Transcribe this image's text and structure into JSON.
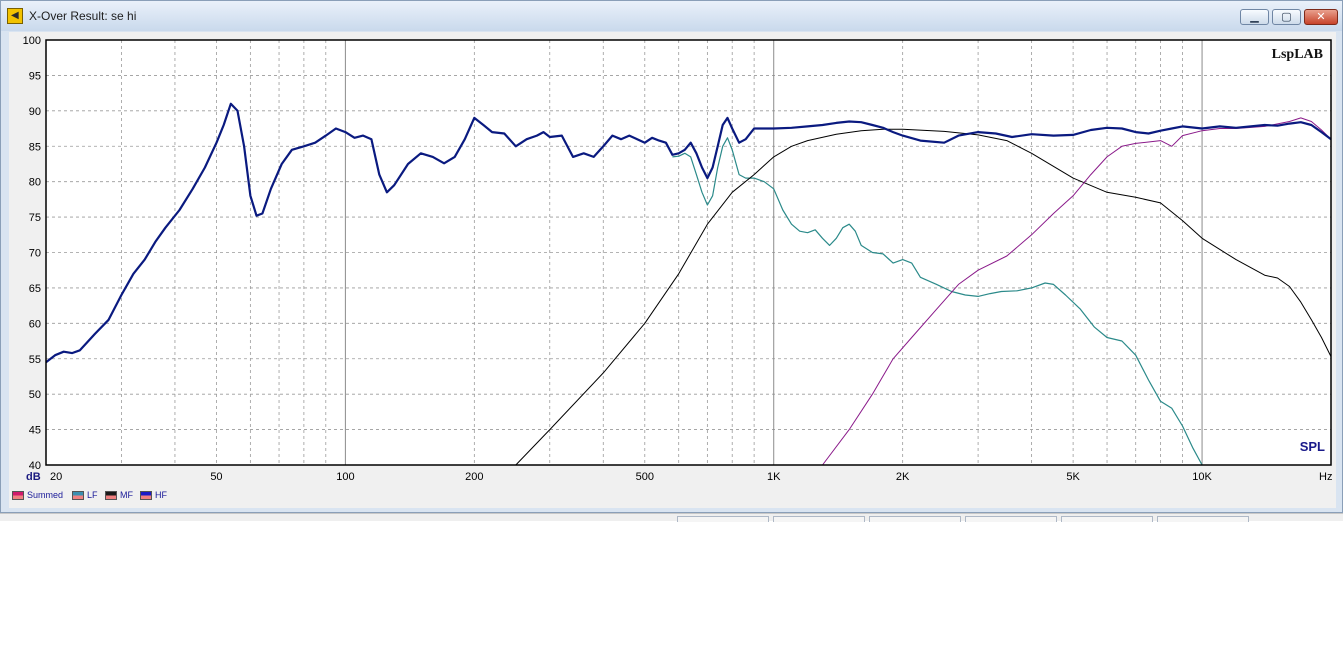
{
  "window": {
    "title": "X-Over Result: se hi",
    "app_icon": "speaker-icon",
    "controls": {
      "minimize": "minimize-icon",
      "maximize": "maximize-icon",
      "close": "close-icon"
    }
  },
  "watermark": "LspLAB",
  "chart_label": "SPL",
  "y_unit": "dB",
  "x_unit": "Hz",
  "legend": [
    {
      "label": "Summed",
      "color": "#d01a6b",
      "id": "summed"
    },
    {
      "label": "LF",
      "color": "#3a8fb0",
      "id": "lf"
    },
    {
      "label": "MF",
      "color": "#1a1a1a",
      "id": "mf"
    },
    {
      "label": "HF",
      "color": "#1a1ac8",
      "id": "hf"
    }
  ],
  "chart_data": {
    "type": "line",
    "title": "",
    "xlabel": "Hz",
    "ylabel": "dB",
    "xscale": "log",
    "xlim": [
      20,
      20000
    ],
    "ylim": [
      40,
      100
    ],
    "grid": true,
    "y_ticks": [
      "100",
      "95",
      "90",
      "85",
      "80",
      "75",
      "70",
      "65",
      "60",
      "55",
      "50",
      "45",
      "40"
    ],
    "x_ticks": [
      {
        "label": "20",
        "value": 20
      },
      {
        "label": "50",
        "value": 50
      },
      {
        "label": "100",
        "value": 100
      },
      {
        "label": "200",
        "value": 200
      },
      {
        "label": "500",
        "value": 500
      },
      {
        "label": "1K",
        "value": 1000
      },
      {
        "label": "2K",
        "value": 2000
      },
      {
        "label": "5K",
        "value": 5000
      },
      {
        "label": "10K",
        "value": 10000
      }
    ],
    "series": [
      {
        "name": "Summed",
        "color": "#0a1a80",
        "width": 2.2,
        "points": [
          [
            20,
            54.5
          ],
          [
            21,
            55.5
          ],
          [
            22,
            56
          ],
          [
            23,
            55.8
          ],
          [
            24,
            56.2
          ],
          [
            26,
            58.5
          ],
          [
            28,
            60.5
          ],
          [
            30,
            64
          ],
          [
            32,
            67
          ],
          [
            34,
            69
          ],
          [
            36,
            71.5
          ],
          [
            38,
            73.5
          ],
          [
            41,
            76
          ],
          [
            44,
            79
          ],
          [
            47,
            82
          ],
          [
            50,
            85.5
          ],
          [
            52,
            88
          ],
          [
            54,
            91
          ],
          [
            56,
            90
          ],
          [
            58,
            85
          ],
          [
            60,
            78
          ],
          [
            62,
            75.2
          ],
          [
            64,
            75.5
          ],
          [
            67,
            79
          ],
          [
            71,
            82.5
          ],
          [
            75,
            84.5
          ],
          [
            80,
            85
          ],
          [
            85,
            85.5
          ],
          [
            90,
            86.5
          ],
          [
            95,
            87.5
          ],
          [
            100,
            87
          ],
          [
            105,
            86.2
          ],
          [
            110,
            86.5
          ],
          [
            115,
            86
          ],
          [
            120,
            81
          ],
          [
            125,
            78.5
          ],
          [
            130,
            79.5
          ],
          [
            140,
            82.5
          ],
          [
            150,
            84
          ],
          [
            160,
            83.5
          ],
          [
            170,
            82.6
          ],
          [
            180,
            83.5
          ],
          [
            190,
            86
          ],
          [
            200,
            89
          ],
          [
            210,
            88
          ],
          [
            220,
            87
          ],
          [
            235,
            86.8
          ],
          [
            250,
            85
          ],
          [
            265,
            86
          ],
          [
            280,
            86.5
          ],
          [
            290,
            87
          ],
          [
            300,
            86.3
          ],
          [
            320,
            86.5
          ],
          [
            340,
            83.5
          ],
          [
            360,
            84
          ],
          [
            380,
            83.5
          ],
          [
            400,
            85
          ],
          [
            420,
            86.5
          ],
          [
            440,
            86
          ],
          [
            460,
            86.5
          ],
          [
            480,
            86
          ],
          [
            500,
            85.5
          ],
          [
            520,
            86.2
          ],
          [
            540,
            85.8
          ],
          [
            560,
            85.5
          ],
          [
            580,
            83.8
          ],
          [
            600,
            84
          ],
          [
            620,
            84.5
          ],
          [
            640,
            85.5
          ],
          [
            660,
            84
          ],
          [
            680,
            82
          ],
          [
            700,
            80.5
          ],
          [
            720,
            82
          ],
          [
            740,
            85
          ],
          [
            760,
            88
          ],
          [
            780,
            89
          ],
          [
            800,
            87.5
          ],
          [
            830,
            85.5
          ],
          [
            860,
            86
          ],
          [
            900,
            87.5
          ],
          [
            1000,
            87.5
          ],
          [
            1100,
            87.6
          ],
          [
            1200,
            87.8
          ],
          [
            1300,
            88
          ],
          [
            1400,
            88.3
          ],
          [
            1500,
            88.5
          ],
          [
            1600,
            88.4
          ],
          [
            1700,
            88
          ],
          [
            1800,
            87.6
          ],
          [
            1900,
            87
          ],
          [
            2000,
            86.5
          ],
          [
            2200,
            85.8
          ],
          [
            2500,
            85.5
          ],
          [
            2700,
            86.5
          ],
          [
            3000,
            87
          ],
          [
            3300,
            86.8
          ],
          [
            3600,
            86.3
          ],
          [
            4000,
            86.7
          ],
          [
            4500,
            86.5
          ],
          [
            5000,
            86.6
          ],
          [
            5500,
            87.3
          ],
          [
            6000,
            87.6
          ],
          [
            6500,
            87.5
          ],
          [
            7000,
            87
          ],
          [
            7500,
            86.8
          ],
          [
            8000,
            87.2
          ],
          [
            8500,
            87.5
          ],
          [
            9000,
            87.8
          ],
          [
            10000,
            87.5
          ],
          [
            11000,
            87.8
          ],
          [
            12000,
            87.6
          ],
          [
            13000,
            87.8
          ],
          [
            14000,
            88
          ],
          [
            15000,
            87.9
          ],
          [
            16000,
            88.2
          ],
          [
            17000,
            88.4
          ],
          [
            18000,
            88
          ],
          [
            19000,
            87
          ],
          [
            20000,
            86
          ]
        ]
      },
      {
        "name": "LF",
        "color": "#2b8a8a",
        "width": 1.2,
        "points": [
          [
            580,
            83.5
          ],
          [
            600,
            83.6
          ],
          [
            620,
            84
          ],
          [
            640,
            83.5
          ],
          [
            660,
            81
          ],
          [
            680,
            78.5
          ],
          [
            700,
            76.7
          ],
          [
            720,
            78
          ],
          [
            740,
            82
          ],
          [
            760,
            85
          ],
          [
            780,
            86.2
          ],
          [
            800,
            84.5
          ],
          [
            830,
            81
          ],
          [
            860,
            80.5
          ],
          [
            900,
            80.5
          ],
          [
            950,
            80
          ],
          [
            1000,
            79
          ],
          [
            1050,
            76
          ],
          [
            1100,
            74
          ],
          [
            1150,
            73
          ],
          [
            1200,
            72.8
          ],
          [
            1250,
            73.2
          ],
          [
            1300,
            72
          ],
          [
            1350,
            71
          ],
          [
            1400,
            72
          ],
          [
            1450,
            73.5
          ],
          [
            1500,
            74
          ],
          [
            1550,
            73
          ],
          [
            1600,
            71
          ],
          [
            1700,
            70
          ],
          [
            1800,
            69.8
          ],
          [
            1900,
            68.5
          ],
          [
            2000,
            69
          ],
          [
            2100,
            68.5
          ],
          [
            2200,
            66.5
          ],
          [
            2400,
            65.5
          ],
          [
            2600,
            64.5
          ],
          [
            2800,
            64
          ],
          [
            3000,
            63.8
          ],
          [
            3200,
            64.2
          ],
          [
            3400,
            64.5
          ],
          [
            3700,
            64.6
          ],
          [
            4000,
            65
          ],
          [
            4300,
            65.7
          ],
          [
            4500,
            65.5
          ],
          [
            4800,
            64
          ],
          [
            5200,
            62
          ],
          [
            5600,
            59.5
          ],
          [
            6000,
            58
          ],
          [
            6500,
            57.5
          ],
          [
            7000,
            55.5
          ],
          [
            7500,
            52
          ],
          [
            8000,
            49
          ],
          [
            8500,
            48
          ],
          [
            9000,
            45.5
          ],
          [
            9500,
            42.5
          ],
          [
            10000,
            40
          ]
        ]
      },
      {
        "name": "MF",
        "color": "#000000",
        "width": 1,
        "points": [
          [
            250,
            40
          ],
          [
            300,
            45
          ],
          [
            400,
            53
          ],
          [
            500,
            60
          ],
          [
            600,
            67
          ],
          [
            700,
            74
          ],
          [
            800,
            78.5
          ],
          [
            900,
            81
          ],
          [
            1000,
            83.5
          ],
          [
            1100,
            85
          ],
          [
            1200,
            85.8
          ],
          [
            1400,
            86.7
          ],
          [
            1600,
            87.2
          ],
          [
            1800,
            87.4
          ],
          [
            2000,
            87.4
          ],
          [
            2500,
            87.1
          ],
          [
            3000,
            86.6
          ],
          [
            3500,
            85.8
          ],
          [
            4000,
            84
          ],
          [
            5000,
            80.5
          ],
          [
            6000,
            78.5
          ],
          [
            7000,
            77.8
          ],
          [
            8000,
            77
          ],
          [
            9000,
            74.5
          ],
          [
            10000,
            72
          ],
          [
            12000,
            69
          ],
          [
            14000,
            66.8
          ],
          [
            15000,
            66.4
          ],
          [
            16000,
            65.2
          ],
          [
            17000,
            63
          ],
          [
            18000,
            60.5
          ],
          [
            19000,
            58
          ],
          [
            20000,
            55.3
          ]
        ]
      },
      {
        "name": "HF",
        "color": "#8a1a8a",
        "width": 1,
        "points": [
          [
            1300,
            40
          ],
          [
            1500,
            45
          ],
          [
            1700,
            50
          ],
          [
            1900,
            55
          ],
          [
            2100,
            58
          ],
          [
            2400,
            62
          ],
          [
            2700,
            65.5
          ],
          [
            3000,
            67.5
          ],
          [
            3500,
            69.5
          ],
          [
            4000,
            72.5
          ],
          [
            4500,
            75.5
          ],
          [
            5000,
            78
          ],
          [
            5500,
            81
          ],
          [
            6000,
            83.5
          ],
          [
            6500,
            85
          ],
          [
            7000,
            85.4
          ],
          [
            7500,
            85.6
          ],
          [
            8000,
            85.8
          ],
          [
            8500,
            85
          ],
          [
            9000,
            86.5
          ],
          [
            10000,
            87.2
          ],
          [
            11000,
            87.5
          ],
          [
            12000,
            87.5
          ],
          [
            14000,
            87.8
          ],
          [
            16000,
            88.5
          ],
          [
            17000,
            89
          ],
          [
            18000,
            88.5
          ],
          [
            19000,
            87.3
          ],
          [
            20000,
            86
          ]
        ]
      }
    ]
  }
}
